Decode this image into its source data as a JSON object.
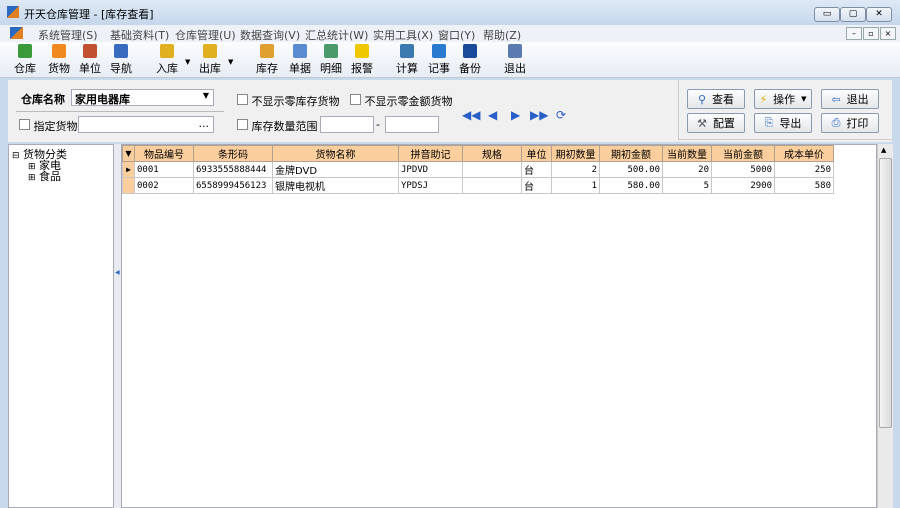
{
  "window": {
    "title": "开天仓库管理 - [库存查看]",
    "min": "▭",
    "max": "▢",
    "close": "✕",
    "mdi": [
      "–",
      "▫",
      "×"
    ]
  },
  "menu": [
    "系统管理(S)",
    "基础资料(T)",
    "仓库管理(U)",
    "数据查询(V)",
    "汇总统计(W)",
    "实用工具(X)",
    "窗口(Y)",
    "帮助(Z)"
  ],
  "toolbar": [
    {
      "label": "仓库",
      "color": "#3a9a3a"
    },
    {
      "label": "货物",
      "color": "#f08a20"
    },
    {
      "label": "单位",
      "color": "#c05030"
    },
    {
      "label": "导航",
      "color": "#3a6ac0"
    },
    {
      "label": "入库",
      "color": "#e0b020"
    },
    {
      "label": "出库",
      "color": "#e0b020"
    },
    {
      "label": "库存",
      "color": "#e0a030"
    },
    {
      "label": "单据",
      "color": "#5a8ad0"
    },
    {
      "label": "明细",
      "color": "#4a9a6a"
    },
    {
      "label": "报警",
      "color": "#f0c800"
    },
    {
      "label": "计算",
      "color": "#3a7ab0"
    },
    {
      "label": "记事",
      "color": "#2a7ad0"
    },
    {
      "label": "备份",
      "color": "#1a4a9a"
    },
    {
      "label": "退出",
      "color": "#5a7ab0"
    }
  ],
  "filter": {
    "warehouse_label": "仓库名称",
    "warehouse_value": "家用电器库",
    "hide_zero_stock": "不显示零库存货物",
    "hide_zero_amount": "不显示零金额货物",
    "specify_goods": "指定货物",
    "ellipsis": "...",
    "stock_range": "库存数量范围",
    "dash": "-"
  },
  "buttons": {
    "view": "查看",
    "operate": "操作",
    "exit": "退出",
    "config": "配置",
    "export": "导出",
    "print": "打印"
  },
  "tree": {
    "root": "货物分类",
    "children": [
      "家电",
      "食品"
    ]
  },
  "table": {
    "headers": [
      "物品编号",
      "条形码",
      "货物名称",
      "拼音助记",
      "规格",
      "单位",
      "期初数量",
      "期初金额",
      "当前数量",
      "当前金额",
      "成本单价"
    ],
    "rows": [
      [
        "0001",
        "6933555888444",
        "金牌DVD",
        "JPDVD",
        "",
        "台",
        "2",
        "500.00",
        "20",
        "5000",
        "250"
      ],
      [
        "0002",
        "6558999456123",
        "银牌电视机",
        "YPDSJ",
        "",
        "台",
        "1",
        "580.00",
        "5",
        "2900",
        "580"
      ]
    ]
  }
}
